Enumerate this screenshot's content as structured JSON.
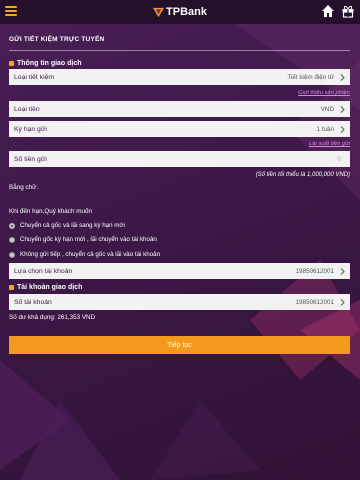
{
  "header": {
    "logo_text": "TPBank",
    "menu_icon": "hamburger-menu-icon",
    "home_icon": "home-icon",
    "gift_icon": "gift-icon"
  },
  "page": {
    "title": "GỬI TIẾT KIỆM TRỰC TUYẾN"
  },
  "section_info": {
    "title": "Thông tin giao dịch",
    "account_type": {
      "label": "Loại tiết kiệm",
      "value": "Tiết kiệm điện tử"
    },
    "product_link": "Giới thiệu sản phẩm",
    "currency": {
      "label": "Loại tiền",
      "value": "VND"
    },
    "term": {
      "label": "Kỳ hạn gửi",
      "value": "1 tuần"
    },
    "rate_link": "Lãi suất tiền gửi",
    "amount": {
      "label": "Số tiền gửi",
      "value": "0"
    },
    "min_note": "(Số tiền tối thiểu là 1,000,000 VND)",
    "in_words_label": "Bằng chữ:",
    "maturity_label": "Khi đến hạn,Quý khách muốn",
    "options": [
      {
        "label": "Chuyển cả gốc và lãi sang kỳ hạn mới",
        "selected": true
      },
      {
        "label": "Chuyển gốc kỳ hạn mới , lãi chuyển vào tài khoản",
        "selected": false
      },
      {
        "label": "Không gửi tiếp , chuyển cả gốc và lãi vào tài khoản",
        "selected": false
      }
    ],
    "select_account": {
      "label": "Lựa chọn tài khoản",
      "value": "19850612001"
    }
  },
  "section_account": {
    "title": "Tài khoản giao dịch",
    "account_no": {
      "label": "Số tài khoản",
      "value": "19850612001"
    },
    "balance": "Số dư khả dụng:  261,353 VND"
  },
  "actions": {
    "continue_label": "Tiếp tục"
  },
  "colors": {
    "accent": "#f39a1d",
    "background": "#3d1847",
    "header": "#24102a"
  }
}
